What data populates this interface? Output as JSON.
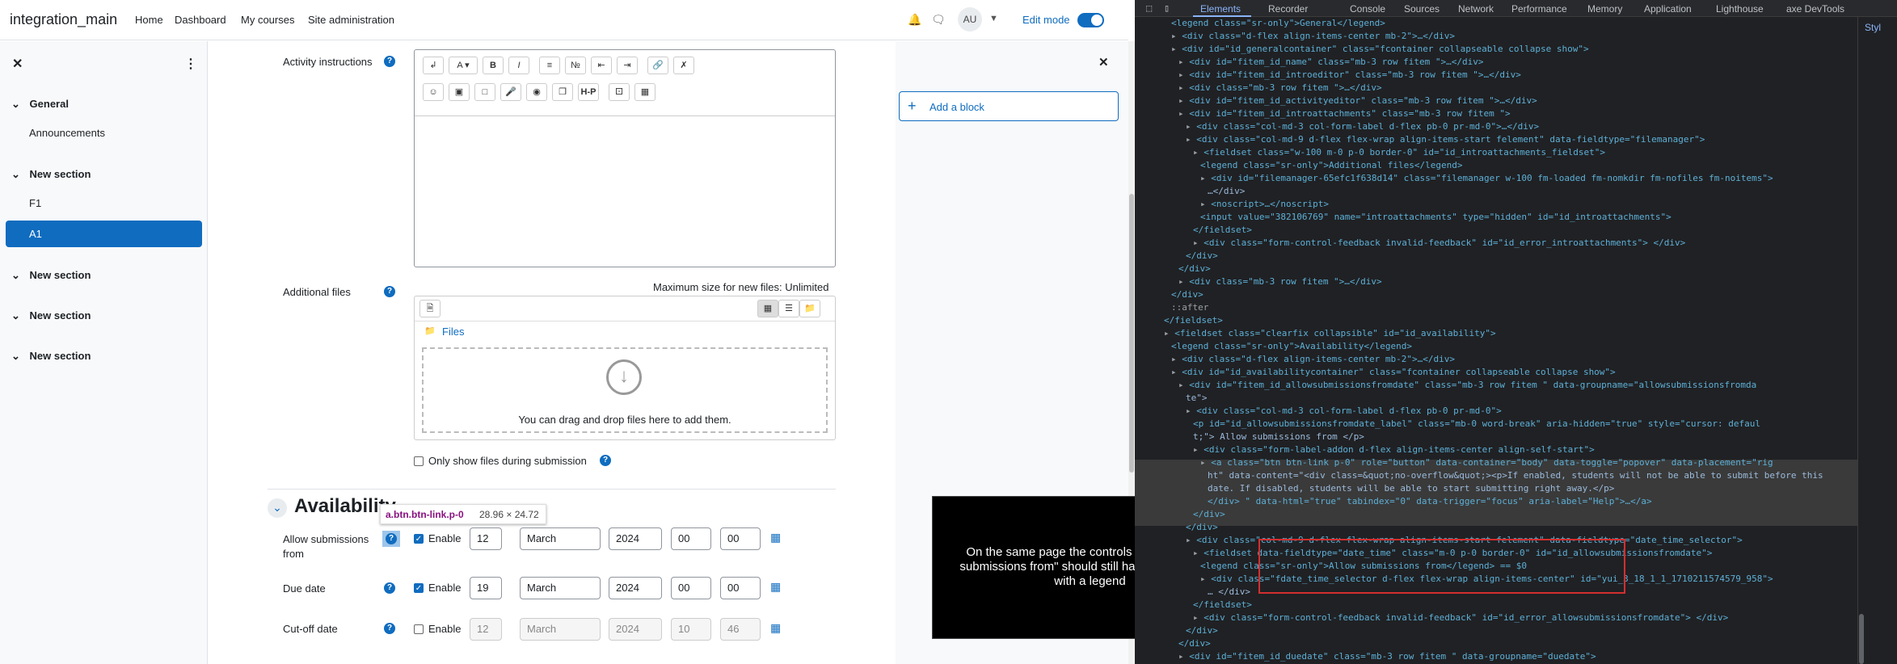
{
  "navbar": {
    "brand": "integration_main",
    "links": [
      "Home",
      "Dashboard",
      "My courses",
      "Site administration"
    ],
    "avatar": "AU",
    "edit_mode": "Edit mode"
  },
  "drawer": {
    "sections": [
      {
        "title": "General",
        "items": [
          "Announcements"
        ]
      },
      {
        "title": "New section",
        "items": [
          "F1",
          "A1"
        ]
      },
      {
        "title": "New section",
        "items": []
      },
      {
        "title": "New section",
        "items": []
      },
      {
        "title": "New section",
        "items": []
      }
    ],
    "active_item": "A1"
  },
  "form": {
    "activity_instructions": "Activity instructions",
    "additional_files": "Additional files",
    "max_size": "Maximum size for new files: Unlimited",
    "files_link": "Files",
    "drop_text": "You can drag and drop files here to add them.",
    "only_show_files": "Only show files during submission",
    "availability_heading": "Availability",
    "allow_from": "Allow submissions from",
    "due_date": "Due date",
    "cutoff_date": "Cut-off date",
    "enable": "Enable",
    "rows": [
      {
        "day": "12",
        "month": "March",
        "year": "2024",
        "hour": "00",
        "minute": "00",
        "enabled": true
      },
      {
        "day": "19",
        "month": "March",
        "year": "2024",
        "hour": "00",
        "minute": "00",
        "enabled": true
      },
      {
        "day": "12",
        "month": "March",
        "year": "2024",
        "hour": "10",
        "minute": "46",
        "enabled": false
      }
    ]
  },
  "blocks": {
    "add_block": "Add a block"
  },
  "tooltip": {
    "selector": "a.btn.btn-link.p-0",
    "size": "28.96 × 24.72"
  },
  "callout": {
    "text": "On the same page the controls such as \"Allow submissions from\" should still have a fieldset tag with a legend"
  },
  "devtools": {
    "tabs": [
      "Elements",
      "Recorder",
      "Console",
      "Sources",
      "Network",
      "Performance",
      "Memory",
      "Application",
      "Lighthouse",
      "axe DevTools"
    ],
    "active_tab": "Elements",
    "styles_label": "Styl",
    "lines": [
      "<legend class=\"sr-only\">General</legend>",
      "<div class=\"d-flex align-items-center mb-2\">…</div>",
      "<div id=\"id_generalcontainer\" class=\"fcontainer collapseable collapse  show\">",
      "<div id=\"fitem_id_name\" class=\"mb-3 row  fitem   \">…</div>",
      "<div id=\"fitem_id_introeditor\" class=\"mb-3 row  fitem   \">…</div>",
      "<div class=\"mb-3 row  fitem   \">…</div>",
      "<div id=\"fitem_id_activityeditor\" class=\"mb-3 row  fitem   \">…</div>",
      "<div id=\"fitem_id_introattachments\" class=\"mb-3 row  fitem   \">",
      "<div class=\"col-md-3 col-form-label d-flex pb-0 pr-md-0\">…</div>",
      "<div class=\"col-md-9 d-flex flex-wrap align-items-start felement\" data-fieldtype=\"filemanager\">",
      "<fieldset class=\"w-100 m-0 p-0 border-0\" id=\"id_introattachments_fieldset\">",
      "<legend class=\"sr-only\">Additional files</legend>",
      "<div id=\"filemanager-65efc1f638d14\" class=\"filemanager w-100 fm-loaded fm-nomkdir fm-nofiles fm-noitems\">",
      "…</div>",
      "<noscript>…</noscript>",
      "<input value=\"382106769\" name=\"introattachments\" type=\"hidden\" id=\"id_introattachments\">",
      "</fieldset>",
      "<div class=\"form-control-feedback invalid-feedback\" id=\"id_error_introattachments\"> </div>",
      "</div>",
      "</div>",
      "<div class=\"mb-3 row  fitem   \">…</div>",
      "</div>",
      "::after",
      "</fieldset>",
      "<fieldset class=\"clearfix collapsible\" id=\"id_availability\">",
      "<legend class=\"sr-only\">Availability</legend>",
      "<div class=\"d-flex align-items-center mb-2\">…</div>",
      "<div id=\"id_availabilitycontainer\" class=\"fcontainer collapseable collapse  show\">",
      "<div id=\"fitem_id_allowsubmissionsfromdate\" class=\"mb-3 row  fitem   \" data-groupname=\"allowsubmissionsfromda",
      "te\">",
      "<div class=\"col-md-3 col-form-label d-flex pb-0 pr-md-0\">",
      "<p id=\"id_allowsubmissionsfromdate_label\" class=\"mb-0 word-break\" aria-hidden=\"true\" style=\"cursor: defaul",
      "t;\"> Allow submissions from </p>",
      "<div class=\"form-label-addon d-flex align-items-center align-self-start\">",
      "<a class=\"btn btn-link p-0\" role=\"button\" data-container=\"body\" data-toggle=\"popover\" data-placement=\"rig",
      "ht\" data-content=\"<div class=&quot;no-overflow&quot;><p>If enabled, students will not be able to submit before this",
      "date. If disabled, students will be able to start submitting right away.</p>",
      "</div> \" data-html=\"true\" tabindex=\"0\" data-trigger=\"focus\" aria-label=\"Help\">…</a>",
      "</div>",
      "</div>",
      "<div class=\"col-md-9 d-flex flex-wrap align-items-start felement\" data-fieldtype=\"date_time_selector\">",
      "<fieldset data-fieldtype=\"date_time\" class=\"m-0 p-0 border-0\" id=\"id_allowsubmissionsfromdate\">",
      "<legend class=\"sr-only\">Allow submissions from</legend> == $0",
      "<div class=\"fdate_time_selector d-flex flex-wrap align-items-center\" id=\"yui_3_18_1_1_1710211574579_958\">",
      "… </div>",
      "</fieldset>",
      "<div class=\"form-control-feedback invalid-feedback\" id=\"id_error_allowsubmissionsfromdate\"> </div>",
      "</div>",
      "</div>",
      "<div id=\"fitem_id_duedate\" class=\"mb-3 row  fitem   \" data-groupname=\"duedate\">"
    ]
  }
}
